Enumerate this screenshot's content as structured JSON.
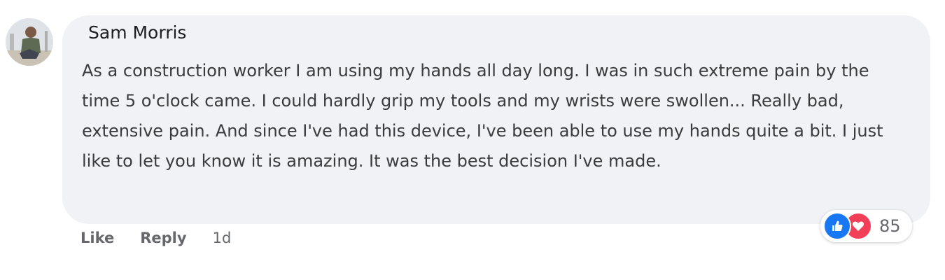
{
  "comment": {
    "author": "Sam Morris",
    "text": "As a construction worker I am using my hands all day long. I was in such extreme pain by the time 5 o'clock came. I could hardly grip my tools and my wrists were swollen... Really bad, extensive pain. And since I've had this device, I've been able to use my hands quite a bit. I just like to let you know it is amazing. It was the best decision I've made.",
    "avatar_icon": "profile-photo",
    "actions": {
      "like_label": "Like",
      "reply_label": "Reply",
      "timestamp": "1d"
    },
    "reactions": {
      "icons": [
        "like-icon",
        "love-icon"
      ],
      "count": "85"
    }
  },
  "colors": {
    "bubble_bg": "#f0f2f5",
    "like_blue": "#1877f2",
    "love_red": "#f33e58",
    "meta_gray": "#65676b"
  }
}
